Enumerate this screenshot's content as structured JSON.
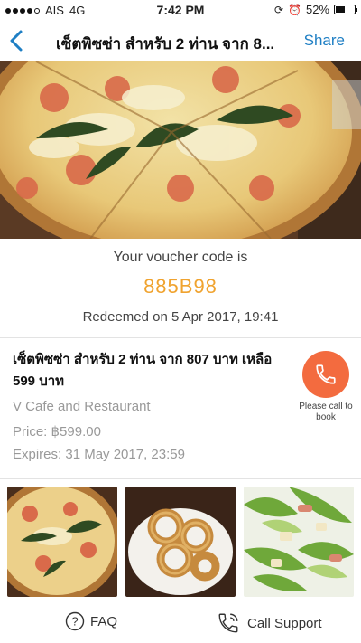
{
  "status": {
    "carrier": "AIS",
    "network": "4G",
    "time": "7:42 PM",
    "battery": "52%",
    "battery_level": 0.52
  },
  "nav": {
    "title": "เซ็ตพิซซ่า สำหรับ 2 ท่าน จาก 8...",
    "share": "Share",
    "back_icon": "chevron-left-icon"
  },
  "voucher": {
    "label": "Your voucher code is",
    "code": "885B98",
    "redeemed": "Redeemed on 5 Apr 2017, 19:41"
  },
  "deal": {
    "title": "เซ็ตพิซซ่า สำหรับ 2 ท่าน จาก 807 บาท เหลือ 599 บาท",
    "merchant": "V Cafe and Restaurant",
    "price": "Price: ฿599.00",
    "expires": "Expires: 31 May 2017, 23:59",
    "call_label": "Please call to book"
  },
  "thumbnails": [
    "pizza-photo",
    "onion-rings-photo",
    "caesar-salad-photo"
  ],
  "footer": {
    "faq": "FAQ",
    "support": "Call Support"
  },
  "colors": {
    "accent": "#1f7fc4",
    "code": "#f0a32f",
    "call": "#f36b3f"
  }
}
